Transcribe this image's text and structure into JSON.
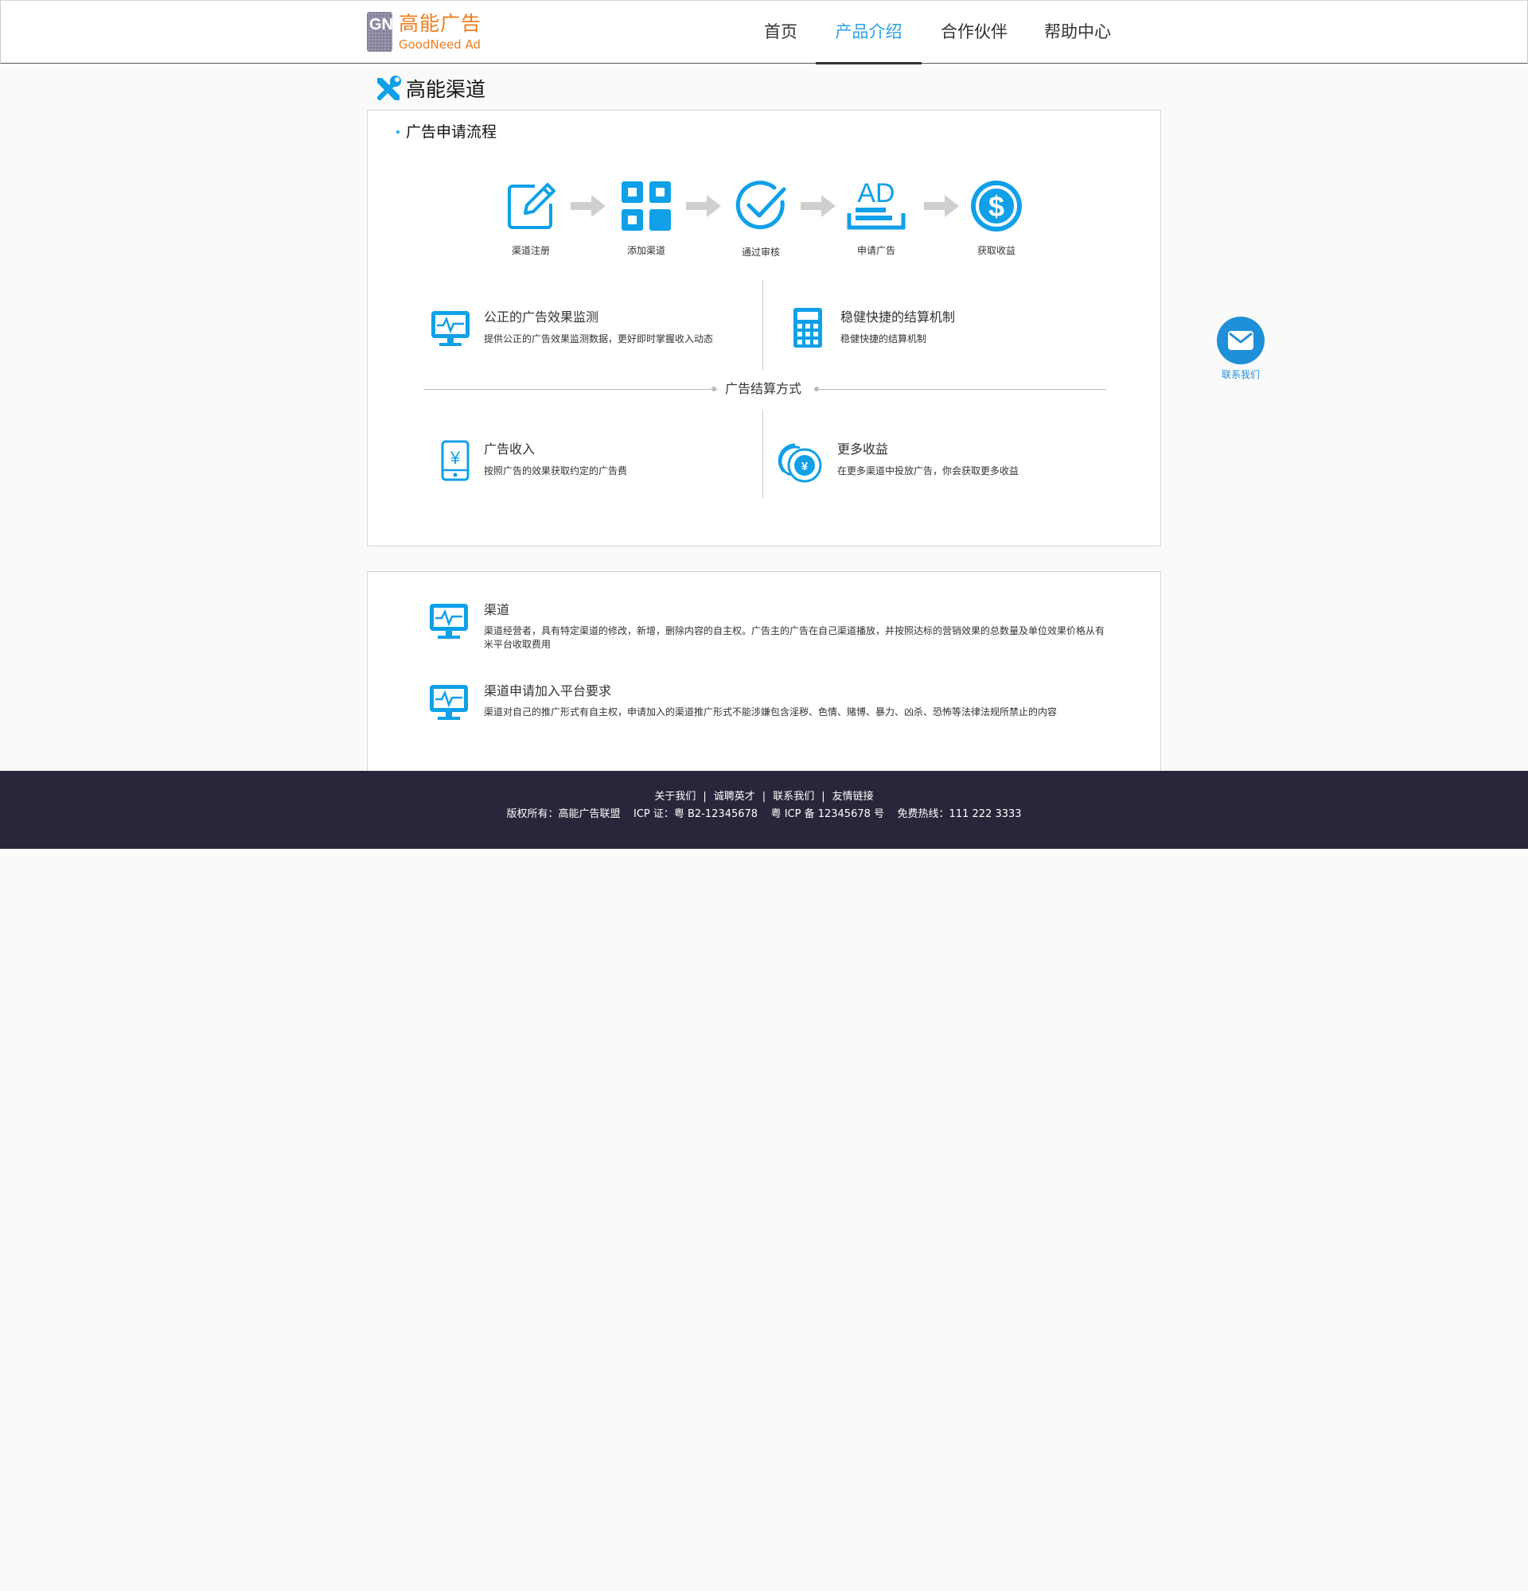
{
  "header": {
    "logo": {
      "cn": "高能广告",
      "en": "GoodNeed Ad",
      "mark_letters": "GN"
    },
    "nav": [
      {
        "label": "首页",
        "active": false
      },
      {
        "label": "产品介绍",
        "active": true
      },
      {
        "label": "合作伙伴",
        "active": false
      },
      {
        "label": "帮助中心",
        "active": false
      }
    ]
  },
  "section": {
    "title": "高能渠道"
  },
  "process": {
    "title": "广告申请流程",
    "steps": [
      {
        "label": "渠道注册",
        "icon": "edit-icon"
      },
      {
        "label": "添加渠道",
        "icon": "grid-icon"
      },
      {
        "label": "通过审核",
        "icon": "check-circle-icon"
      },
      {
        "label": "申请广告",
        "icon": "ad-icon"
      },
      {
        "label": "获取收益",
        "icon": "dollar-circle-icon"
      }
    ],
    "ad_icon_text": "AD",
    "money_symbol": "$"
  },
  "features": {
    "top": [
      {
        "title": "公正的广告效果监测",
        "desc": "提供公正的广告效果监测数据，更好即时掌握收入动态",
        "icon": "monitor-icon"
      },
      {
        "title": "稳健快捷的结算机制",
        "desc": "稳健快捷的结算机制",
        "icon": "calculator-icon"
      }
    ],
    "divider": "广告结算方式",
    "bottom": [
      {
        "title": "广告收入",
        "desc": "按照广告的效果获取约定的广告费",
        "icon": "phone-yen-icon"
      },
      {
        "title": "更多收益",
        "desc": "在更多渠道中投放广告，你会获取更多收益",
        "icon": "coins-yen-icon"
      }
    ],
    "yen_symbol": "¥"
  },
  "info": [
    {
      "title": "渠道",
      "text": "渠道经营者，具有特定渠道的修改，新增，删除内容的自主权。广告主的广告在自己渠道播放，并按照达标的营销效果的总数量及单位效果价格从有米平台收取费用",
      "icon": "monitor-icon"
    },
    {
      "title": "渠道申请加入平台要求",
      "text": "渠道对自己的推广形式有自主权，申请加入的渠道推广形式不能涉嫌包含淫秽、色情、赌博、暴力、凶杀、恐怖等法律法规所禁止的内容",
      "icon": "monitor-icon"
    }
  ],
  "contact": {
    "label": "联系我们",
    "icon": "mail-icon"
  },
  "footer": {
    "links": [
      "关于我们",
      "诚聘英才",
      "联系我们",
      "友情链接"
    ],
    "separator": "|",
    "copyright": "版权所有：高能广告联盟    ICP 证：粤 B2-12345678    粤 ICP 备 12345678 号    免费热线：111 222 3333"
  },
  "colors": {
    "accent": "#0fa0e8",
    "nav_active": "#29a3e6",
    "logo": "#f07d1e",
    "footer_bg": "#27263a",
    "contact": "#1e8fd8"
  }
}
